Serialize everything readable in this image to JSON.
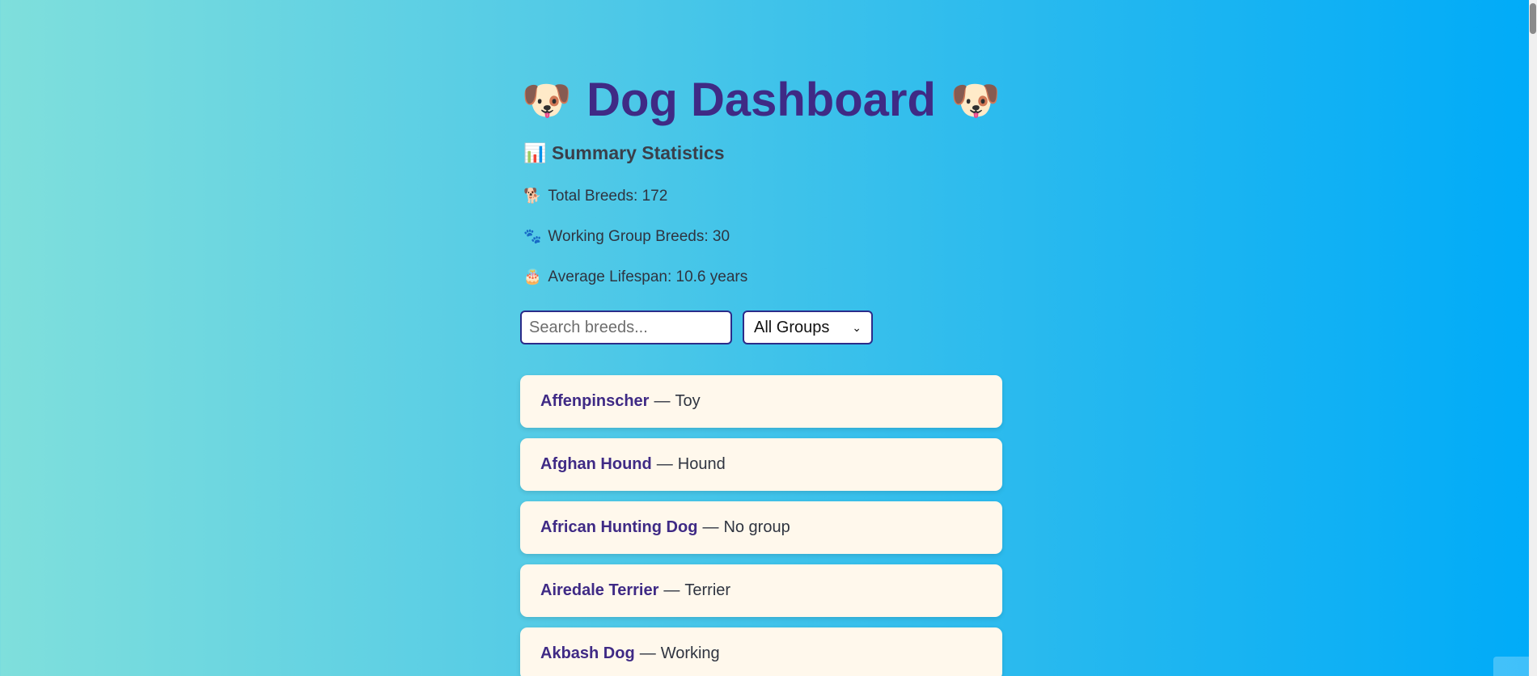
{
  "header": {
    "title": "Dog Dashboard",
    "left_emoji": "🐶",
    "right_emoji": "🐶"
  },
  "summary": {
    "heading_emoji": "📊",
    "heading": "Summary Statistics",
    "stats": [
      {
        "emoji": "🐕",
        "text": "Total Breeds: 172"
      },
      {
        "emoji": "🐾",
        "text": "Working Group Breeds: 30"
      },
      {
        "emoji": "🎂",
        "text": "Average Lifespan: 10.6 years"
      }
    ]
  },
  "controls": {
    "search_placeholder": "Search breeds...",
    "group_selected": "All Groups"
  },
  "breeds": [
    {
      "name": "Affenpinscher",
      "group": "Toy"
    },
    {
      "name": "Afghan Hound",
      "group": "Hound"
    },
    {
      "name": "African Hunting Dog",
      "group": "No group"
    },
    {
      "name": "Airedale Terrier",
      "group": "Terrier"
    },
    {
      "name": "Akbash Dog",
      "group": "Working"
    }
  ],
  "separator": "—",
  "colors": {
    "title": "#3f2a85",
    "card_bg": "#fff8ec",
    "input_border": "#2b2c8a"
  }
}
